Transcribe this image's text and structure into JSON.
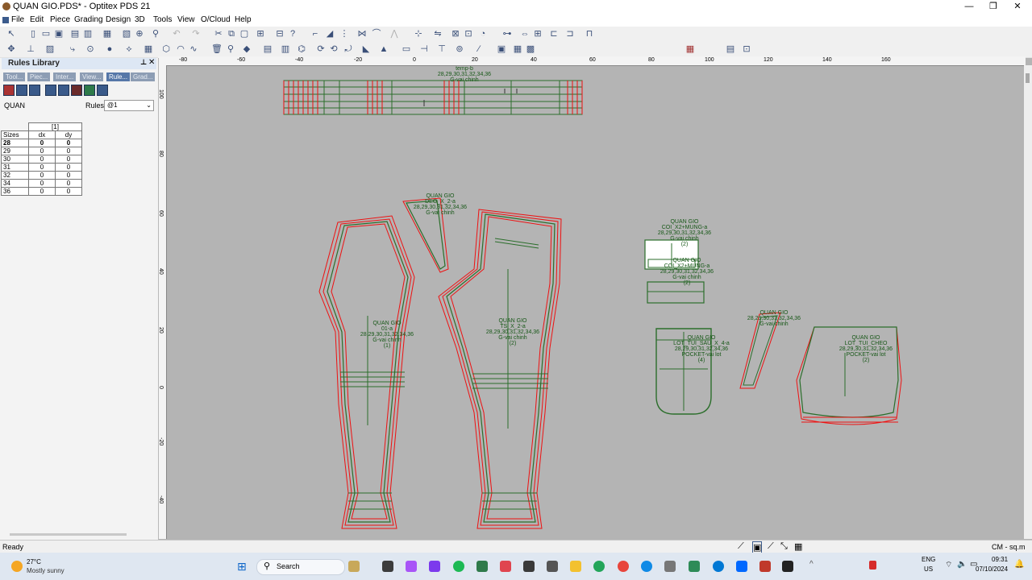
{
  "window": {
    "title": "QUAN GIO.PDS* - Optitex PDS 21",
    "minimize": "—",
    "maximize": "❐",
    "close": "✕"
  },
  "menu": [
    "File",
    "Edit",
    "Piece",
    "Grading",
    "Design",
    "3D",
    "Tools",
    "View",
    "O/Cloud",
    "Help"
  ],
  "rules_panel": {
    "title": "Rules Library",
    "pin": "⊥",
    "close": "✕",
    "tabs": [
      "Tool...",
      "Piec...",
      "Inter...",
      "View...",
      "Rule...",
      "Grad..."
    ],
    "active_tab": 4,
    "piece_name": "QUAN",
    "rules_label": "Rules",
    "rules_value": "@1",
    "table": {
      "group_header": "[1]",
      "columns": [
        "Sizes",
        "dx",
        "dy"
      ],
      "rows": [
        [
          "28",
          "0",
          "0"
        ],
        [
          "29",
          "0",
          "0"
        ],
        [
          "30",
          "0",
          "0"
        ],
        [
          "31",
          "0",
          "0"
        ],
        [
          "32",
          "0",
          "0"
        ],
        [
          "34",
          "0",
          "0"
        ],
        [
          "36",
          "0",
          "0"
        ]
      ]
    }
  },
  "ruler": {
    "top": [
      "-80",
      "-60",
      "-40",
      "-20",
      "0",
      "20",
      "40",
      "60",
      "80",
      "100",
      "120",
      "140",
      "160"
    ],
    "left": [
      "100",
      "80",
      "60",
      "40",
      "20",
      "0",
      "-20",
      "-40"
    ]
  },
  "pieces": {
    "waistband": [
      "temp-b",
      "28,29,30,31,32,34,36",
      "G-vai chinh"
    ],
    "front": [
      "QUAN GIO",
      "01-a",
      "28,29,30,31,32,34,36",
      "G-vai chinh",
      "(1)"
    ],
    "fly": [
      "QUAN GIO",
      "DEO_X_2-a",
      "28,29,30,31,32,34,36",
      "G-vai chinh"
    ],
    "back": [
      "QUAN GIO",
      "TS_X_2-a",
      "28,29,30,31,32,34,36",
      "G-vai chinh",
      "(2)"
    ],
    "coi": [
      "QUAN GIO",
      "COI_X2+MUNG-a",
      "28,29,30,31,32,34,36",
      "G-vai chinh",
      "(2)"
    ],
    "coi2": [
      "QUAN GIO",
      "COI_X2+MUNG-a",
      "28,29,30,31,32,34,36",
      "G-vai chinh",
      "(2)"
    ],
    "pocket_back": [
      "QUAN GIO",
      "LOT_TUI_SAU_X_4-a",
      "28,29,30,31,32,34,36",
      "POCKET-vai lot",
      "(4)"
    ],
    "small": [
      "QUAN GIO",
      "28,29,30,31,32,34,36",
      "G-vai chinh"
    ],
    "pocket_side": [
      "QUAN GIO",
      "LOT_TUI_CHEO",
      "28,29,30,31,32,34,36",
      "POCKET-vai lot",
      "(2)"
    ]
  },
  "status": {
    "left": "Ready",
    "units": "CM - sq.m"
  },
  "taskbar": {
    "weather_temp": "27°C",
    "weather_desc": "Mostly sunny",
    "search": "Search",
    "lang1": "ENG",
    "lang2": "US",
    "time": "09:31",
    "date": "07/10/2024"
  }
}
